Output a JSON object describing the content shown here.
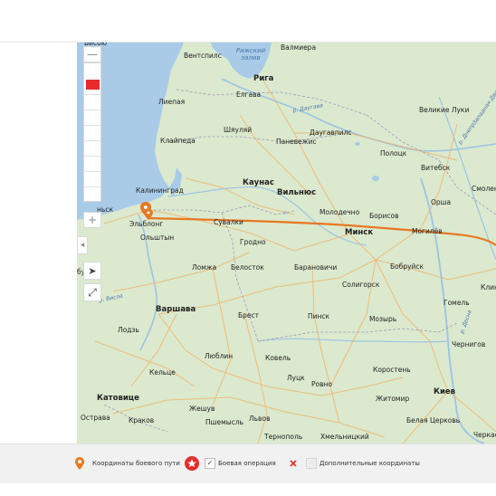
{
  "map": {
    "controls": {
      "zoom_out": "—",
      "zoom_in": "+",
      "collapse": "◂",
      "locate": "➤",
      "fullscreen": "⤢"
    },
    "cities": [
      {
        "name": "Валмиера",
        "cls": "big"
      },
      {
        "name": "Вентспилс",
        "cls": "big"
      },
      {
        "name": "Рига",
        "cls": "cap"
      },
      {
        "name": "Елгава",
        "cls": "big"
      },
      {
        "name": "Лиепая",
        "cls": "big"
      },
      {
        "name": "Шяуляй",
        "cls": "big"
      },
      {
        "name": "Паневежис",
        "cls": "big"
      },
      {
        "name": "Даугавпилс",
        "cls": "big"
      },
      {
        "name": "Великие Луки",
        "cls": "big"
      },
      {
        "name": "Клайпеда",
        "cls": "big"
      },
      {
        "name": "Полоцк",
        "cls": "big"
      },
      {
        "name": "Витебск",
        "cls": "big"
      },
      {
        "name": "Каунас",
        "cls": "cap"
      },
      {
        "name": "Вильнюс",
        "cls": "cap"
      },
      {
        "name": "Калининград",
        "cls": "big"
      },
      {
        "name": "Смолен",
        "cls": "big"
      },
      {
        "name": "Орша",
        "cls": "big"
      },
      {
        "name": "Молодечно",
        "cls": "big"
      },
      {
        "name": "Борисов",
        "cls": "big"
      },
      {
        "name": "Могилёв",
        "cls": "big"
      },
      {
        "name": "Эльблонг",
        "cls": "big"
      },
      {
        "name": "Сувалки",
        "cls": "big"
      },
      {
        "name": "Минск",
        "cls": "cap"
      },
      {
        "name": "Ольштын",
        "cls": "big"
      },
      {
        "name": "Гродно",
        "cls": "big"
      },
      {
        "name": "Бобруйск",
        "cls": "big"
      },
      {
        "name": "Ломжа",
        "cls": "big"
      },
      {
        "name": "Белосток",
        "cls": "big"
      },
      {
        "name": "Барановичи",
        "cls": "big"
      },
      {
        "name": "Солигорск",
        "cls": "big"
      },
      {
        "name": "Клинц",
        "cls": "big"
      },
      {
        "name": "Варшава",
        "cls": "cap"
      },
      {
        "name": "Брест",
        "cls": "big"
      },
      {
        "name": "Пинск",
        "cls": "big"
      },
      {
        "name": "Мозырь",
        "cls": "big"
      },
      {
        "name": "Гомель",
        "cls": "big"
      },
      {
        "name": "Лодзь",
        "cls": "big"
      },
      {
        "name": "Чернигов",
        "cls": "big"
      },
      {
        "name": "Люблин",
        "cls": "big"
      },
      {
        "name": "Ковель",
        "cls": "big"
      },
      {
        "name": "Кельце",
        "cls": "big"
      },
      {
        "name": "Луцк",
        "cls": "big"
      },
      {
        "name": "Ровно",
        "cls": "big"
      },
      {
        "name": "Коростень",
        "cls": "big"
      },
      {
        "name": "Катовице",
        "cls": "cap"
      },
      {
        "name": "Киев",
        "cls": "cap"
      },
      {
        "name": "Жешув",
        "cls": "big"
      },
      {
        "name": "Житомир",
        "cls": "big"
      },
      {
        "name": "Острава",
        "cls": "big"
      },
      {
        "name": "Краков",
        "cls": "big"
      },
      {
        "name": "Пшемысль",
        "cls": "big"
      },
      {
        "name": "Львов",
        "cls": "big"
      },
      {
        "name": "Белая Церковь",
        "cls": "big"
      },
      {
        "name": "Тернополь",
        "cls": "big"
      },
      {
        "name": "Хмельницкий",
        "cls": "big"
      },
      {
        "name": "Черкасс",
        "cls": "big"
      },
      {
        "name": "Висбю",
        "cls": "big"
      },
      {
        "name": "бург",
        "cls": "big"
      },
      {
        "name": "ньск",
        "cls": "big"
      }
    ],
    "water_labels": [
      {
        "name": "Рижский залив"
      },
      {
        "name": "р. Висла"
      },
      {
        "name": "р. Десна"
      },
      {
        "name": "р. Даугава"
      },
      {
        "name": "р. Днепр"
      },
      {
        "name": "Западная Двина"
      }
    ],
    "route_color": "#e87722",
    "water_color": "#a9cbe8",
    "land_color": "#dbe9cf",
    "marker_icon": "map-pin-icon"
  },
  "legend": {
    "items": [
      {
        "label": "Координаты боевого пути",
        "icon": "pin-icon"
      },
      {
        "label": "Боевая операция",
        "icon": "star-badge-icon",
        "checked": true
      },
      {
        "label": "Дополнительные координаты",
        "icon": "cross-dot-icon",
        "checked": false
      }
    ],
    "check_mark": "✓"
  }
}
